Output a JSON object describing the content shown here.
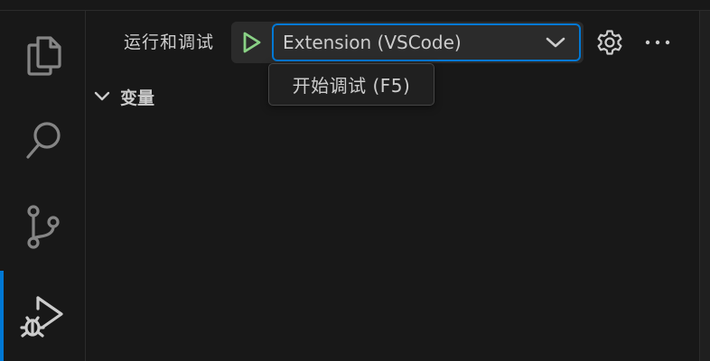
{
  "header": {
    "title": "运行和调试",
    "config_selected": "Extension (VSCode)"
  },
  "icons": {
    "explorer": "files-icon",
    "search": "search-icon",
    "source_control": "source-control-icon",
    "run_debug": "run-debug-icon",
    "run": "play-icon",
    "gear": "gear-icon",
    "more": "ellipsis-icon"
  },
  "sections": {
    "variables": "变量"
  },
  "tooltip": {
    "text": "开始调试 (F5)"
  },
  "colors": {
    "background": "#181818",
    "accent": "#0078d4",
    "run_green": "#89d185",
    "text": "#cccccc"
  }
}
